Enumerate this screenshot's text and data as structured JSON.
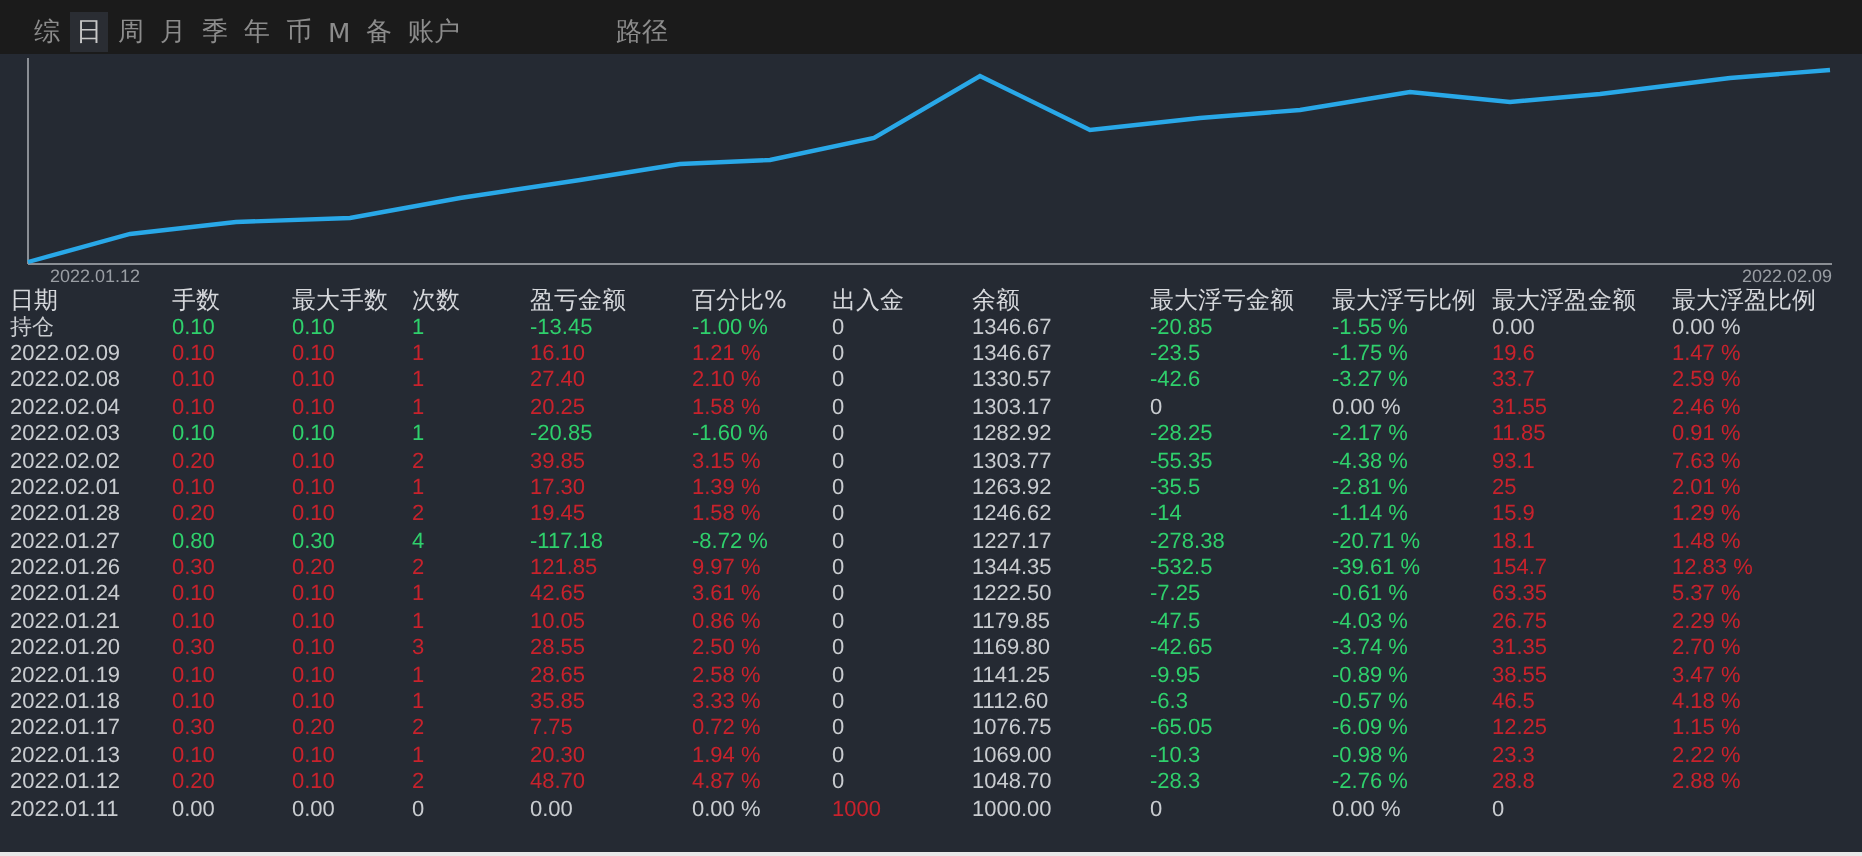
{
  "tabs": [
    {
      "label": "综",
      "selected": false
    },
    {
      "label": "日",
      "selected": true
    },
    {
      "label": "周",
      "selected": false
    },
    {
      "label": "月",
      "selected": false
    },
    {
      "label": "季",
      "selected": false
    },
    {
      "label": "年",
      "selected": false
    },
    {
      "label": "币",
      "selected": false
    },
    {
      "label": "M",
      "selected": false
    },
    {
      "label": "备",
      "selected": false
    },
    {
      "label": "账户",
      "selected": false
    }
  ],
  "path_tab": {
    "label": "路径",
    "selected": false
  },
  "chart": {
    "start_label": "2022.01.12",
    "end_label": "2022.02.09"
  },
  "table": {
    "columns": [
      "日期",
      "手数",
      "最大手数",
      "次数",
      "盈亏金额",
      "百分比%",
      "出入金",
      "余额",
      "最大浮亏金额",
      "最大浮亏比例",
      "最大浮盈金额",
      "最大浮盈比例"
    ],
    "rows": [
      {
        "color": "#2fd06c",
        "drawdown": true,
        "runup": false,
        "deposit": false,
        "cells": [
          "持仓",
          "0.10",
          "0.10",
          "1",
          "-13.45",
          "-1.00 %",
          "0",
          "1346.67",
          "-20.85",
          "-1.55 %",
          "0.00",
          "0.00 %"
        ]
      },
      {
        "color": "#c8222c",
        "drawdown": true,
        "runup": true,
        "deposit": false,
        "cells": [
          "2022.02.09",
          "0.10",
          "0.10",
          "1",
          "16.10",
          "1.21 %",
          "0",
          "1346.67",
          "-23.5",
          "-1.75 %",
          "19.6",
          "1.47 %"
        ]
      },
      {
        "color": "#c8222c",
        "drawdown": true,
        "runup": true,
        "deposit": false,
        "cells": [
          "2022.02.08",
          "0.10",
          "0.10",
          "1",
          "27.40",
          "2.10 %",
          "0",
          "1330.57",
          "-42.6",
          "-3.27 %",
          "33.7",
          "2.59 %"
        ]
      },
      {
        "color": "#c8222c",
        "drawdown": false,
        "runup": true,
        "deposit": false,
        "cells": [
          "2022.02.04",
          "0.10",
          "0.10",
          "1",
          "20.25",
          "1.58 %",
          "0",
          "1303.17",
          "0",
          "0.00 %",
          "31.55",
          "2.46 %"
        ]
      },
      {
        "color": "#2fd06c",
        "drawdown": true,
        "runup": true,
        "deposit": false,
        "cells": [
          "2022.02.03",
          "0.10",
          "0.10",
          "1",
          "-20.85",
          "-1.60 %",
          "0",
          "1282.92",
          "-28.25",
          "-2.17 %",
          "11.85",
          "0.91 %"
        ]
      },
      {
        "color": "#c8222c",
        "drawdown": true,
        "runup": true,
        "deposit": false,
        "cells": [
          "2022.02.02",
          "0.20",
          "0.10",
          "2",
          "39.85",
          "3.15 %",
          "0",
          "1303.77",
          "-55.35",
          "-4.38 %",
          "93.1",
          "7.63 %"
        ]
      },
      {
        "color": "#c8222c",
        "drawdown": true,
        "runup": true,
        "deposit": false,
        "cells": [
          "2022.02.01",
          "0.10",
          "0.10",
          "1",
          "17.30",
          "1.39 %",
          "0",
          "1263.92",
          "-35.5",
          "-2.81 %",
          "25",
          "2.01 %"
        ]
      },
      {
        "color": "#c8222c",
        "drawdown": true,
        "runup": true,
        "deposit": false,
        "cells": [
          "2022.01.28",
          "0.20",
          "0.10",
          "2",
          "19.45",
          "1.58 %",
          "0",
          "1246.62",
          "-14",
          "-1.14 %",
          "15.9",
          "1.29 %"
        ]
      },
      {
        "color": "#2fd06c",
        "drawdown": true,
        "runup": true,
        "deposit": false,
        "cells": [
          "2022.01.27",
          "0.80",
          "0.30",
          "4",
          "-117.18",
          "-8.72 %",
          "0",
          "1227.17",
          "-278.38",
          "-20.71 %",
          "18.1",
          "1.48 %"
        ]
      },
      {
        "color": "#c8222c",
        "drawdown": true,
        "runup": true,
        "deposit": false,
        "cells": [
          "2022.01.26",
          "0.30",
          "0.20",
          "2",
          "121.85",
          "9.97 %",
          "0",
          "1344.35",
          "-532.5",
          "-39.61 %",
          "154.7",
          "12.83 %"
        ]
      },
      {
        "color": "#c8222c",
        "drawdown": true,
        "runup": true,
        "deposit": false,
        "cells": [
          "2022.01.24",
          "0.10",
          "0.10",
          "1",
          "42.65",
          "3.61 %",
          "0",
          "1222.50",
          "-7.25",
          "-0.61 %",
          "63.35",
          "5.37 %"
        ]
      },
      {
        "color": "#c8222c",
        "drawdown": true,
        "runup": true,
        "deposit": false,
        "cells": [
          "2022.01.21",
          "0.10",
          "0.10",
          "1",
          "10.05",
          "0.86 %",
          "0",
          "1179.85",
          "-47.5",
          "-4.03 %",
          "26.75",
          "2.29 %"
        ]
      },
      {
        "color": "#c8222c",
        "drawdown": true,
        "runup": true,
        "deposit": false,
        "cells": [
          "2022.01.20",
          "0.30",
          "0.10",
          "3",
          "28.55",
          "2.50 %",
          "0",
          "1169.80",
          "-42.65",
          "-3.74 %",
          "31.35",
          "2.70 %"
        ]
      },
      {
        "color": "#c8222c",
        "drawdown": true,
        "runup": true,
        "deposit": false,
        "cells": [
          "2022.01.19",
          "0.10",
          "0.10",
          "1",
          "28.65",
          "2.58 %",
          "0",
          "1141.25",
          "-9.95",
          "-0.89 %",
          "38.55",
          "3.47 %"
        ]
      },
      {
        "color": "#c8222c",
        "drawdown": true,
        "runup": true,
        "deposit": false,
        "cells": [
          "2022.01.18",
          "0.10",
          "0.10",
          "1",
          "35.85",
          "3.33 %",
          "0",
          "1112.60",
          "-6.3",
          "-0.57 %",
          "46.5",
          "4.18 %"
        ]
      },
      {
        "color": "#c8222c",
        "drawdown": true,
        "runup": true,
        "deposit": false,
        "cells": [
          "2022.01.17",
          "0.30",
          "0.20",
          "2",
          "7.75",
          "0.72 %",
          "0",
          "1076.75",
          "-65.05",
          "-6.09 %",
          "12.25",
          "1.15 %"
        ]
      },
      {
        "color": "#c8222c",
        "drawdown": true,
        "runup": true,
        "deposit": false,
        "cells": [
          "2022.01.13",
          "0.10",
          "0.10",
          "1",
          "20.30",
          "1.94 %",
          "0",
          "1069.00",
          "-10.3",
          "-0.98 %",
          "23.3",
          "2.22 %"
        ]
      },
      {
        "color": "#c8222c",
        "drawdown": true,
        "runup": true,
        "deposit": false,
        "cells": [
          "2022.01.12",
          "0.20",
          "0.10",
          "2",
          "48.70",
          "4.87 %",
          "0",
          "1048.70",
          "-28.3",
          "-2.76 %",
          "28.8",
          "2.88 %"
        ]
      },
      {
        "color": "#c9ccd0",
        "drawdown": false,
        "runup": false,
        "deposit": true,
        "cells": [
          "2022.01.11",
          "0.00",
          "0.00",
          "0",
          "0.00",
          "0.00 %",
          "1000",
          "1000.00",
          "0",
          "0.00 %",
          "0"
        ]
      }
    ]
  }
}
